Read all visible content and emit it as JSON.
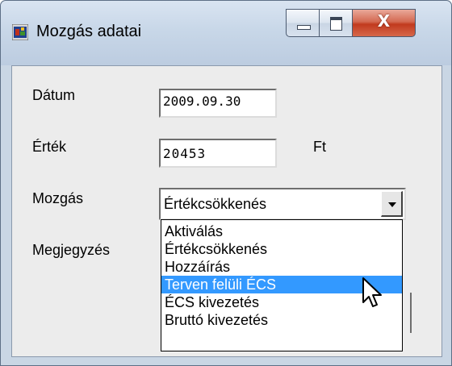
{
  "window": {
    "title": "Mozgás adatai",
    "close_glyph": "X",
    "icons": {
      "app": "app-icon",
      "minimize": "minimize-icon",
      "maximize": "maximize-icon",
      "close": "close-icon"
    }
  },
  "form": {
    "date_label": "Dátum",
    "date_value": "2009.09.30",
    "value_label": "Érték",
    "value_value": "20453",
    "currency": "Ft",
    "movement_label": "Mozgás",
    "movement_selected": "Értékcsökkenés",
    "note_label": "Megjegyzés"
  },
  "dropdown": {
    "options": [
      "Aktiválás",
      "Értékcsökkenés",
      "Hozzáírás",
      "Terven felüli ÉCS",
      "ÉCS kivezetés",
      "Bruttó kivezetés"
    ],
    "highlighted": "Terven felüli ÉCS"
  },
  "colors": {
    "selection": "#3399ff",
    "dialog_face": "#ececec",
    "frame": "#c9d6e4",
    "close_button": "#c13a1e"
  }
}
